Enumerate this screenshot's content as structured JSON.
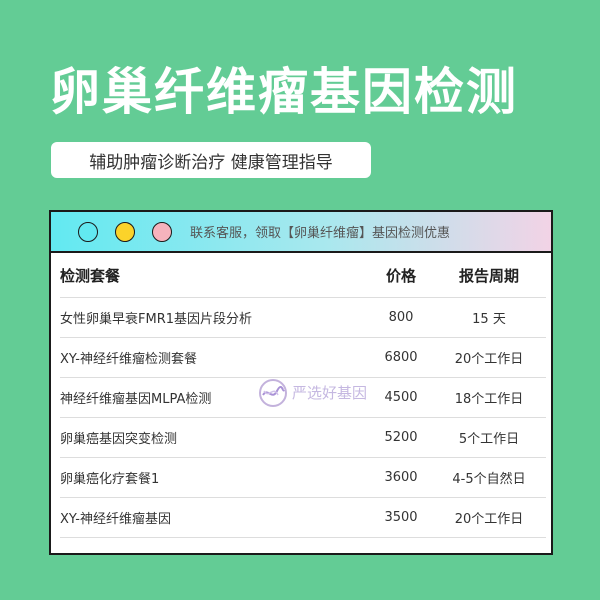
{
  "header": {
    "title": "卵巢纤维瘤基因检测",
    "subtitle": "辅助肿瘤诊断治疗 健康管理指导"
  },
  "window": {
    "banner_text": "联系客服，领取【卵巢纤维瘤】基因检测优惠",
    "dots": [
      "cyan",
      "yellow",
      "pink"
    ]
  },
  "table": {
    "headers": [
      "检测套餐",
      "价格",
      "报告周期"
    ],
    "rows": [
      {
        "name": "女性卵巢早衰FMR1基因片段分析",
        "price": "800",
        "period": "15 天"
      },
      {
        "name": "XY-神经纤维瘤检测套餐",
        "price": "6800",
        "period": "20个工作日"
      },
      {
        "name": "神经纤维瘤基因MLPA检测",
        "price": "4500",
        "period": "18个工作日"
      },
      {
        "name": "卵巢癌基因突变检测",
        "price": "5200",
        "period": "5个工作日"
      },
      {
        "name": "卵巢癌化疗套餐1",
        "price": "3600",
        "period": "4-5个自然日"
      },
      {
        "name": "XY-神经纤维瘤基因",
        "price": "3500",
        "period": "20个工作日"
      }
    ]
  },
  "watermark": {
    "brand": "严选好基因"
  },
  "colors": {
    "background": "#63cc95",
    "dot_cyan": "#62e9f1",
    "dot_yellow": "#fbd32a",
    "dot_pink": "#f6b3bd"
  }
}
